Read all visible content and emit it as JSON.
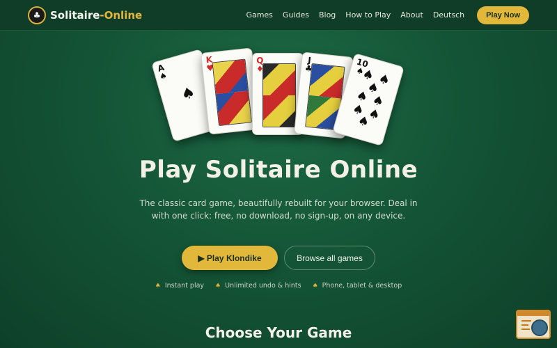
{
  "header": {
    "logo_icon": "card-suits-icon",
    "logo_text_main": "Solitaire",
    "logo_text_accent": "-Online",
    "nav": [
      "Games",
      "Guides",
      "Blog",
      "How to Play",
      "About",
      "Deutsch"
    ],
    "cta_label": "Play Now"
  },
  "cards": [
    {
      "rank": "A",
      "suit": "♠",
      "color": "black"
    },
    {
      "rank": "K",
      "suit": "♥",
      "color": "red"
    },
    {
      "rank": "Q",
      "suit": "♦",
      "color": "red"
    },
    {
      "rank": "J",
      "suit": "♣",
      "color": "black"
    },
    {
      "rank": "10",
      "suit": "♠",
      "color": "black"
    }
  ],
  "hero": {
    "title": "Play Solitaire Online",
    "subtitle": "The classic card game, beautifully rebuilt for your browser. Deal in with one click: free, no download, no sign-up, on any device.",
    "primary_button": "▶ Play Klondike",
    "secondary_button": "Browse all games",
    "features": [
      "Instant play",
      "Unlimited undo & hints",
      "Phone, tablet & desktop"
    ]
  },
  "section": {
    "title": "Choose Your Game"
  },
  "colors": {
    "accent": "#e2b83a",
    "background": "#145536",
    "header": "#103d27"
  }
}
